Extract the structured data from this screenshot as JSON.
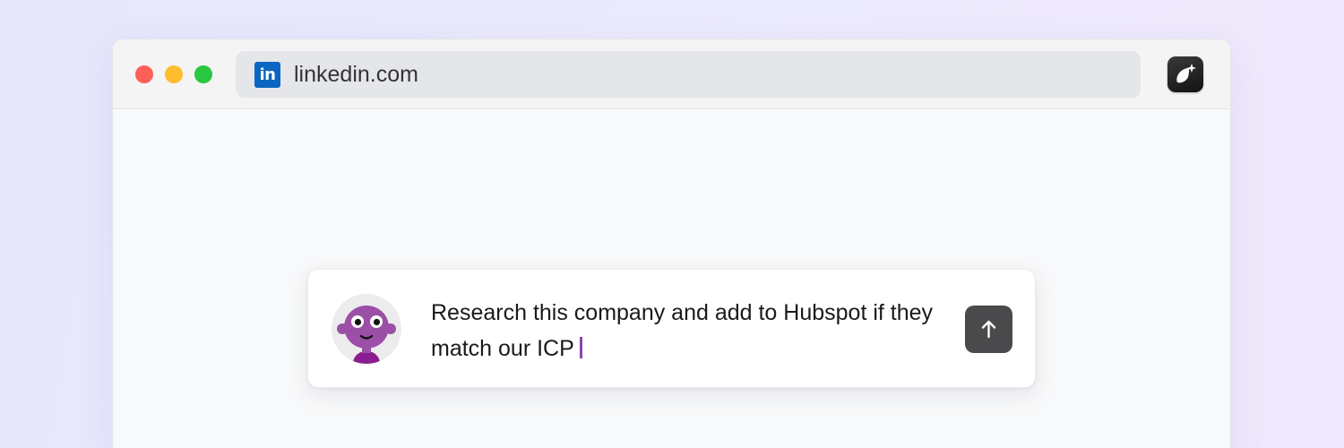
{
  "browser": {
    "window_controls": [
      "close",
      "minimize",
      "maximize"
    ],
    "address_bar": {
      "site_icon": "linkedin-icon",
      "site_icon_text": "in",
      "url": "linkedin.com"
    },
    "extension_icon": "ai-extension-icon"
  },
  "prompt": {
    "avatar_icon": "purple-character-avatar",
    "text": "Research this company and add to Hubspot if they match our ICP",
    "send_icon": "arrow-up-icon"
  },
  "colors": {
    "linkedin_blue": "#0a66c2",
    "caret_purple": "#8e44ad",
    "avatar_purple": "#9b4fa6",
    "send_button": "#4a4a4c"
  }
}
